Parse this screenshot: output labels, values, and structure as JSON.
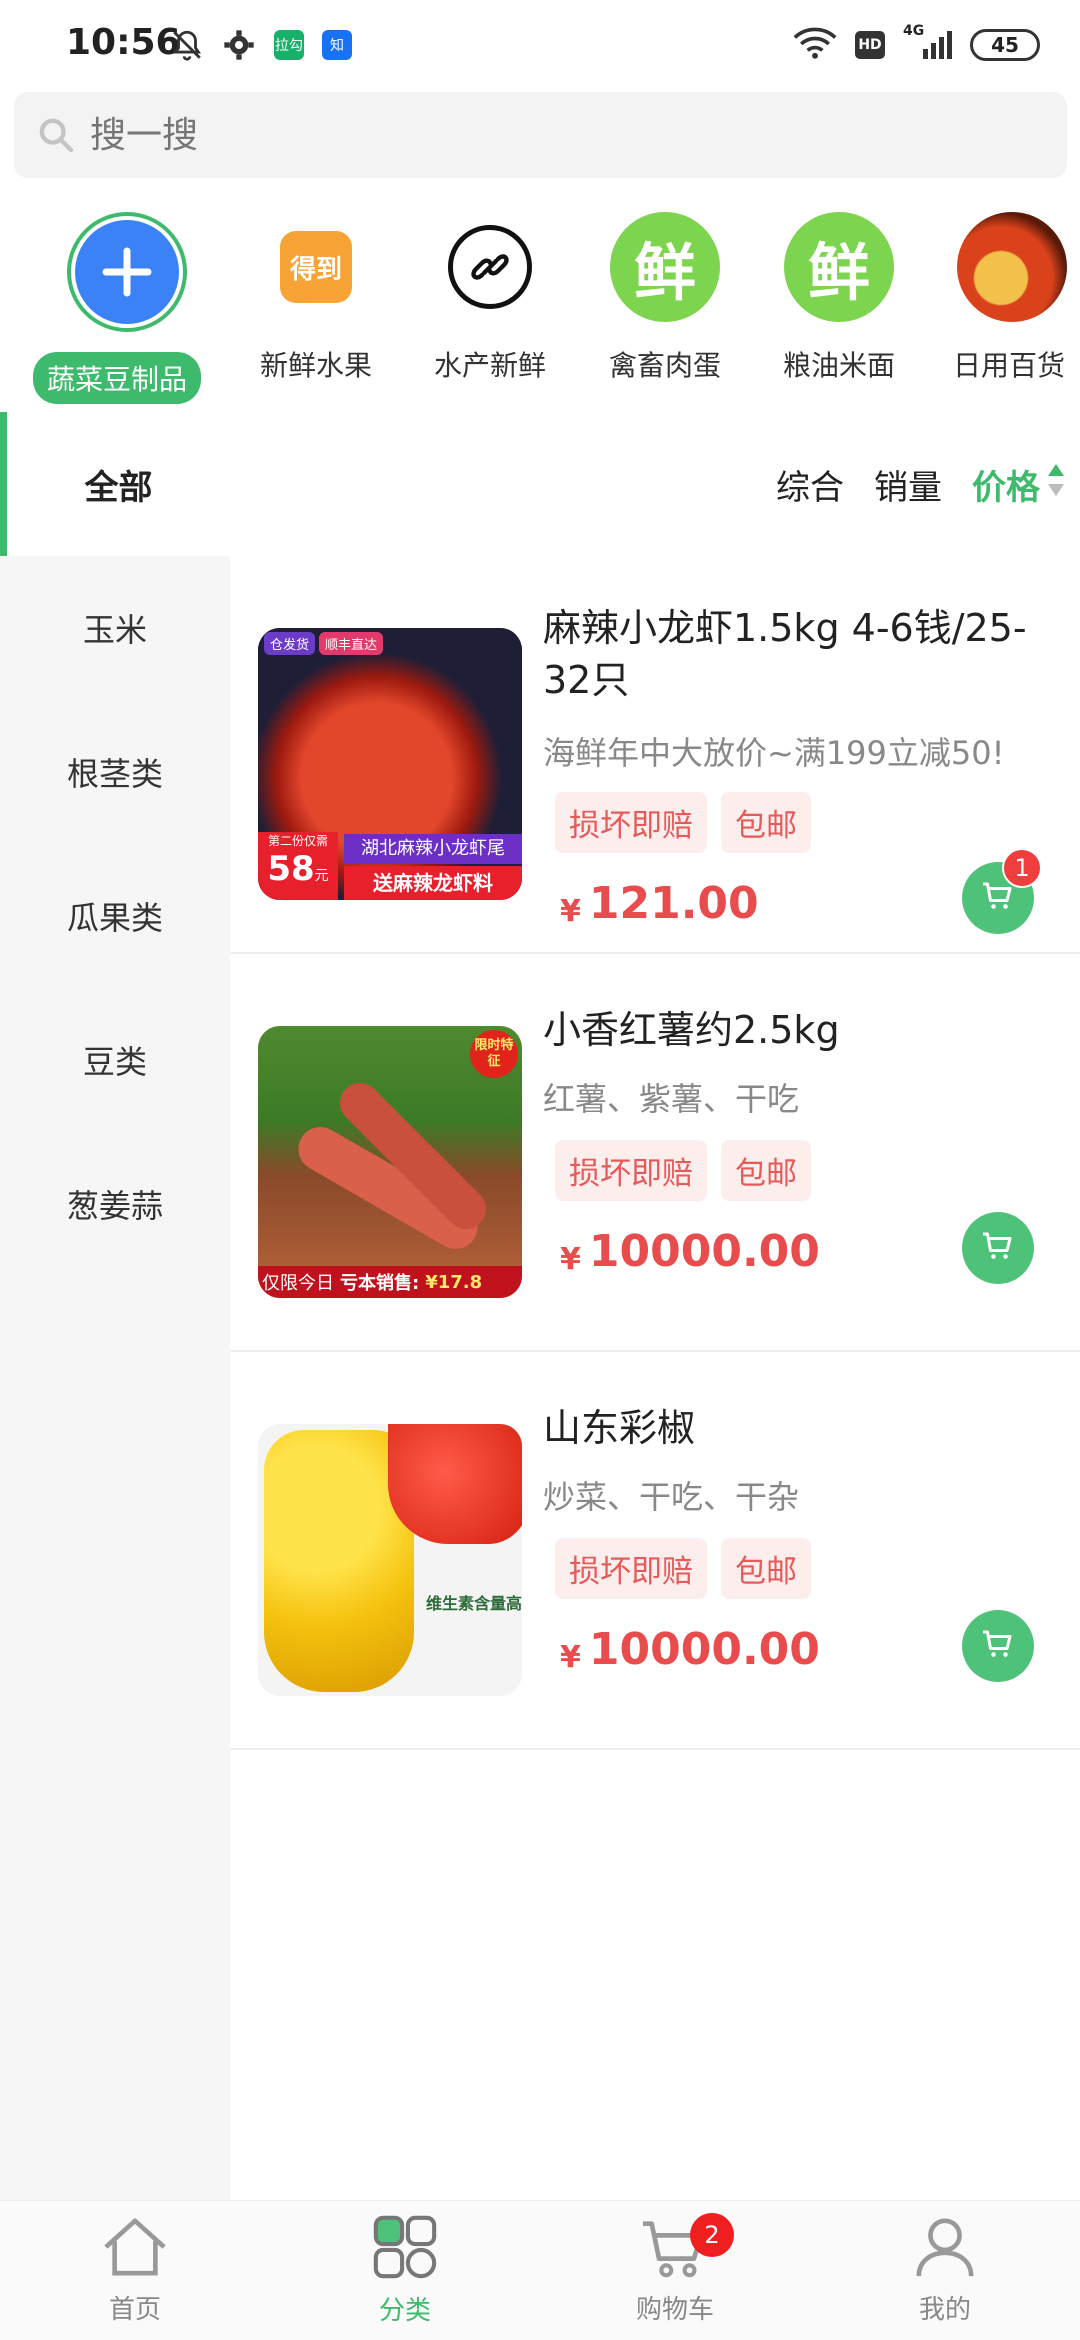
{
  "status_bar": {
    "time": "10:56",
    "network": "4G",
    "hd": "HD",
    "battery": "45",
    "app_icon_1": "拉勾",
    "app_icon_2": "知"
  },
  "search": {
    "placeholder": "搜一搜"
  },
  "categories": [
    {
      "label": "蔬菜豆制品",
      "icon": "plus-icon",
      "active": true
    },
    {
      "label": "新鲜水果",
      "icon": "dedao-icon",
      "badge_text": "得到"
    },
    {
      "label": "水产新鲜",
      "icon": "link-icon"
    },
    {
      "label": "禽畜肉蛋",
      "icon": "fresh-icon",
      "badge_text": "鲜"
    },
    {
      "label": "粮油米面",
      "icon": "fresh-icon",
      "badge_text": "鲜"
    },
    {
      "label": "日用百货",
      "icon": "food-photo-icon"
    }
  ],
  "sort": {
    "all_label": "全部",
    "options": [
      "综合",
      "销量",
      "价格"
    ],
    "active": "价格"
  },
  "left_list": [
    "玉米",
    "根茎类",
    "瓜果类",
    "豆类",
    "葱姜蒜"
  ],
  "products": [
    {
      "title": "麻辣小龙虾1.5kg 4-6钱/25-32只",
      "subtitle": "海鲜年中大放价~满199立减50!",
      "tags": [
        "损坏即赔",
        "包邮"
      ],
      "currency": "¥",
      "price": "121.00",
      "cart_badge": "1",
      "thumb_text": [
        "仓发货",
        "顺丰直达",
        "湖北麻辣小龙虾尾",
        "送麻辣龙虾料",
        "58",
        "第二份仅需",
        "元"
      ]
    },
    {
      "title": "小香红薯约2.5kg",
      "subtitle": "红薯、紫薯、干吃",
      "tags": [
        "损坏即赔",
        "包邮"
      ],
      "currency": "¥",
      "price": "10000.00",
      "thumb_text": [
        "限时特征",
        "仅限今日",
        "亏本销售:",
        "¥17.8"
      ]
    },
    {
      "title": "山东彩椒",
      "subtitle": "炒菜、干吃、干杂",
      "tags": [
        "损坏即赔",
        "包邮"
      ],
      "currency": "¥",
      "price": "10000.00",
      "thumb_text": [
        "维生素含量高"
      ]
    }
  ],
  "bottom_nav": [
    {
      "label": "首页",
      "icon": "home-icon"
    },
    {
      "label": "分类",
      "icon": "category-icon",
      "active": true
    },
    {
      "label": "购物车",
      "icon": "cart-icon",
      "badge": "2"
    },
    {
      "label": "我的",
      "icon": "user-icon"
    }
  ],
  "colors": {
    "accent": "#3dba6b",
    "price": "#e84c4c",
    "tag_bg": "#fdeeee"
  }
}
